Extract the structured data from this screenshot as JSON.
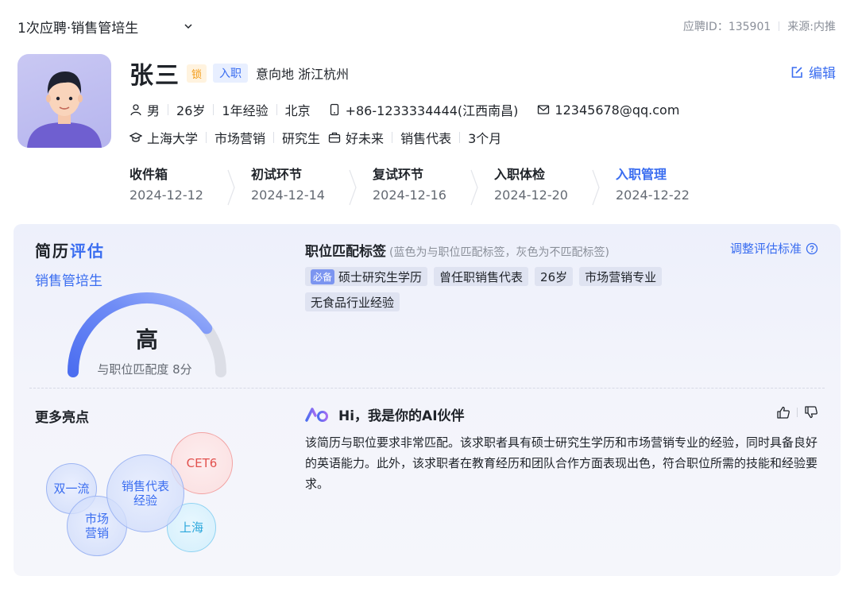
{
  "header": {
    "job_select": "1次应聘·销售管培生",
    "apply_id": "应聘ID：135901",
    "source": "来源:内推"
  },
  "candidate": {
    "name": "张三",
    "lock_tag": "锁",
    "stage_tag": "入职",
    "intent_location": "意向地 浙江杭州",
    "edit_label": "编辑",
    "gender": "男",
    "age": "26岁",
    "experience": "1年经验",
    "city": "北京",
    "phone": "+86-1233334444(江西南昌)",
    "email": "12345678@qq.com",
    "school": "上海大学",
    "major": "市场营销",
    "degree": "研究生",
    "company": "好未来",
    "position": "销售代表",
    "duration": "3个月"
  },
  "stages": [
    {
      "name": "收件箱",
      "date": "2024-12-12",
      "active": false
    },
    {
      "name": "初试环节",
      "date": "2024-12-14",
      "active": false
    },
    {
      "name": "复试环节",
      "date": "2024-12-16",
      "active": false
    },
    {
      "name": "入职体检",
      "date": "2024-12-20",
      "active": false
    },
    {
      "name": "入职管理",
      "date": "2024-12-22",
      "active": true
    }
  ],
  "evaluation": {
    "title_a": "简历",
    "title_b": "评估",
    "job": "销售管培生",
    "level": "高",
    "score_label": "与职位匹配度 8分",
    "score": 8,
    "score_max": 10
  },
  "match_tags": {
    "title": "职位匹配标签",
    "hint": "(蓝色为与职位匹配标签，灰色为不匹配标签)",
    "adjust_label": "调整评估标准",
    "must_label": "必备",
    "tags": [
      "硕士研究生学历",
      "曾任职销售代表",
      "26岁",
      "市场营销专业",
      "无食品行业经验"
    ]
  },
  "highlights": {
    "title": "更多亮点",
    "bubbles": [
      "双一流",
      "销售代表经验",
      "CET6",
      "市场营销",
      "上海"
    ]
  },
  "ai": {
    "title": "Hi，我是你的AI伙伴",
    "summary": "该简历与职位要求非常匹配。该求职者具有硕士研究生学历和市场营销专业的经验，同时具备良好的英语能力。此外，该求职者在教育经历和团队合作方面表现出色，符合职位所需的技能和经验要求。"
  },
  "colors": {
    "accent": "#3a6df0",
    "lock": "#f39b17",
    "danger": "#e2514e",
    "cyan": "#2aa7dc"
  }
}
